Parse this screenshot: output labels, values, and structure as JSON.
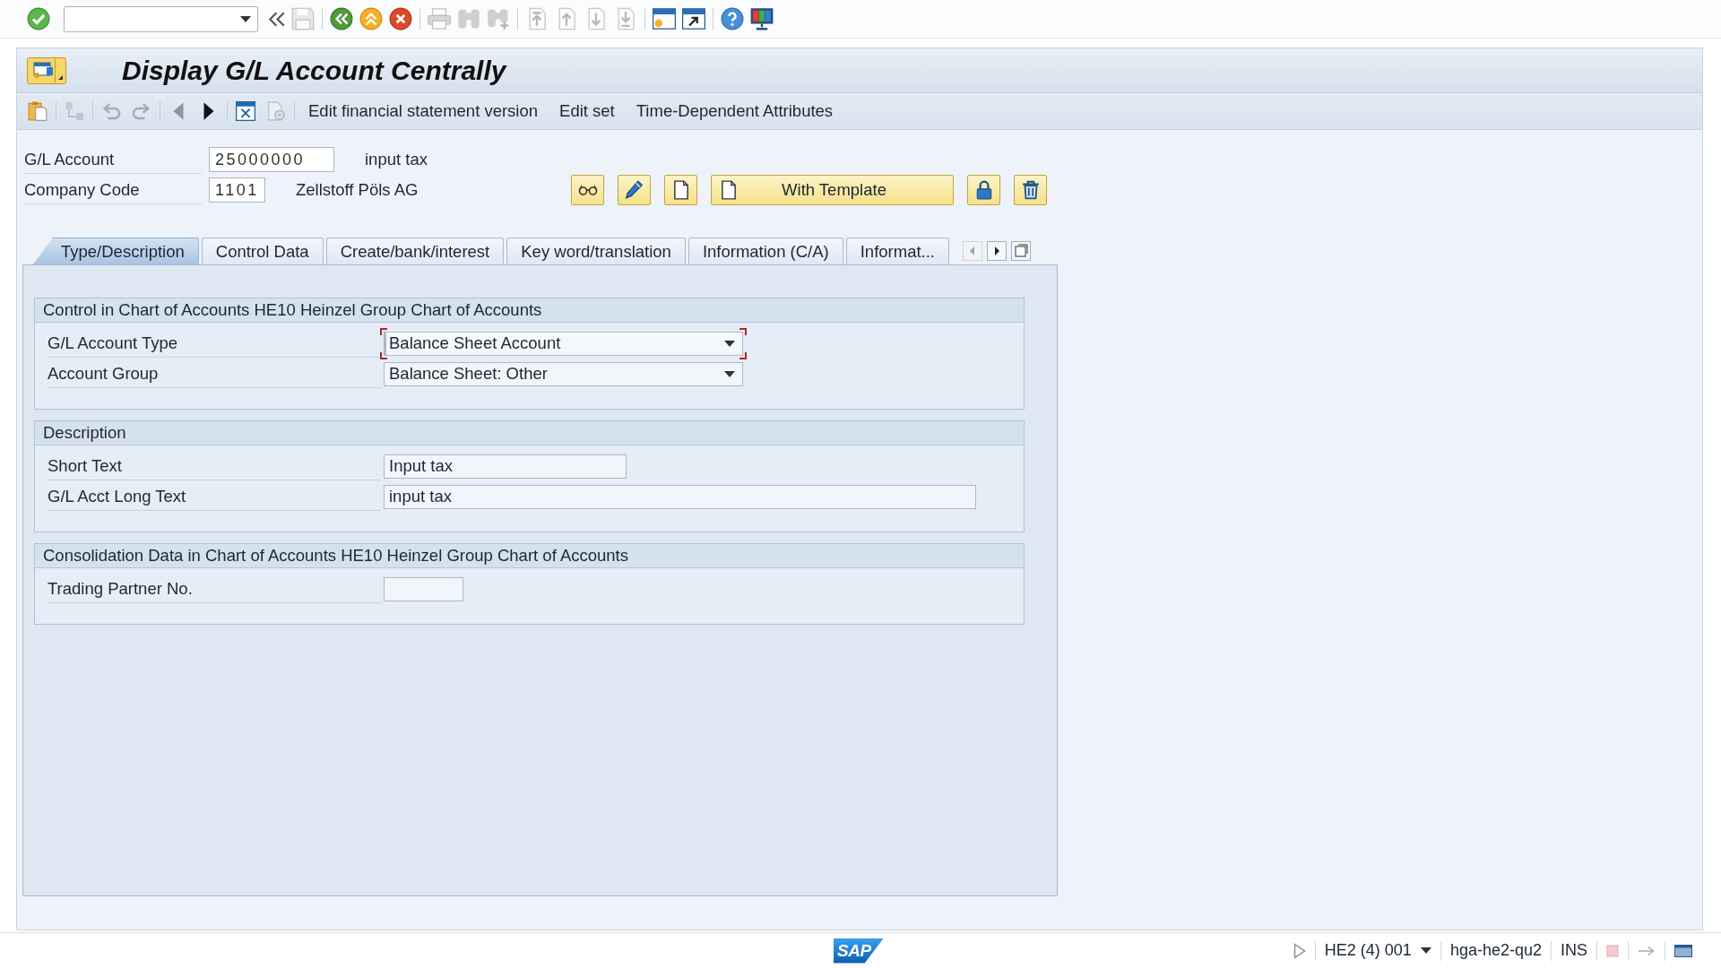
{
  "system_toolbar": {
    "lead": [
      {
        "kind": "enter",
        "disabled": false
      }
    ],
    "groups": [
      [
        {
          "kind": "collapse",
          "disabled": false
        },
        {
          "kind": "save",
          "disabled": true
        }
      ],
      [
        {
          "kind": "back",
          "disabled": false
        },
        {
          "kind": "exit",
          "disabled": false
        },
        {
          "kind": "cancel",
          "disabled": false
        }
      ],
      [
        {
          "kind": "print",
          "disabled": true
        },
        {
          "kind": "find",
          "disabled": true
        },
        {
          "kind": "find-next",
          "disabled": true
        }
      ],
      [
        {
          "kind": "first-page",
          "disabled": true
        },
        {
          "kind": "previous-page",
          "disabled": true
        },
        {
          "kind": "next-page",
          "disabled": true
        },
        {
          "kind": "last-page",
          "disabled": true
        }
      ],
      [
        {
          "kind": "new-session",
          "disabled": false
        },
        {
          "kind": "shortcut",
          "disabled": false
        }
      ],
      [
        {
          "kind": "help",
          "disabled": false
        },
        {
          "kind": "layout",
          "disabled": false
        }
      ]
    ]
  },
  "window": {
    "title": "Display G/L Account Centrally"
  },
  "app_toolbar": {
    "groups": [
      [
        {
          "kind": "other-object",
          "disabled": false
        }
      ],
      [
        {
          "kind": "hierarchy",
          "disabled": true
        }
      ],
      [
        {
          "kind": "undo",
          "disabled": true
        },
        {
          "kind": "redo",
          "disabled": true
        }
      ],
      [
        {
          "kind": "previous",
          "disabled": true
        },
        {
          "kind": "next",
          "disabled": false
        }
      ],
      [
        {
          "kind": "display-document",
          "disabled": false
        },
        {
          "kind": "document-settings",
          "disabled": true
        }
      ]
    ],
    "buttons": [
      "Edit financial statement version",
      "Edit set",
      "Time-Dependent Attributes"
    ]
  },
  "header": {
    "fields": [
      {
        "label": "G/L Account",
        "kind": "account",
        "value": "25000000",
        "description": "input tax"
      },
      {
        "label": "Company Code",
        "kind": "code",
        "value": "1101",
        "description": "Zellstoff Pöls AG"
      }
    ],
    "buttons": [
      {
        "kind": "display"
      },
      {
        "kind": "edit"
      },
      {
        "kind": "create"
      },
      {
        "kind": "template",
        "label": "With Template"
      },
      {
        "kind": "lock"
      },
      {
        "kind": "delete"
      }
    ]
  },
  "tabs": [
    {
      "label": "Type/Description",
      "selected": true
    },
    {
      "label": "Control Data",
      "selected": false
    },
    {
      "label": "Create/bank/interest",
      "selected": false
    },
    {
      "label": "Key word/translation",
      "selected": false
    },
    {
      "label": "Information (C/A)",
      "selected": false
    },
    {
      "label": "Informat...",
      "selected": false
    }
  ],
  "tab_nav": [
    {
      "kind": "left",
      "disabled": true
    },
    {
      "kind": "right",
      "disabled": false
    },
    {
      "kind": "list",
      "disabled": false
    }
  ],
  "groups": [
    {
      "title": "Control in Chart of Accounts HE10 Heinzel Group Chart of Accounts",
      "rows": [
        {
          "label": "G/L Account Type",
          "kind": "dropdown",
          "value": "Balance Sheet Account",
          "focused": true
        },
        {
          "label": "Account Group",
          "kind": "dropdown",
          "value": "Balance Sheet: Other",
          "focused": false
        }
      ]
    },
    {
      "title": "Description",
      "rows": [
        {
          "label": "Short Text",
          "kind": "text",
          "value": "Input tax",
          "focused": false
        },
        {
          "label": "G/L Acct Long Text",
          "kind": "long-text",
          "value": "input tax",
          "focused": false
        }
      ]
    },
    {
      "title": "Consolidation Data in Chart of Accounts HE10 Heinzel Group Chart of Accounts",
      "rows": [
        {
          "label": "Trading Partner No.",
          "kind": "id",
          "focused": false
        }
      ]
    }
  ],
  "status_bar": {
    "logo": "SAP",
    "system": "HE2 (4) 001",
    "server": "hga-he2-qu2",
    "mode": "INS"
  }
}
